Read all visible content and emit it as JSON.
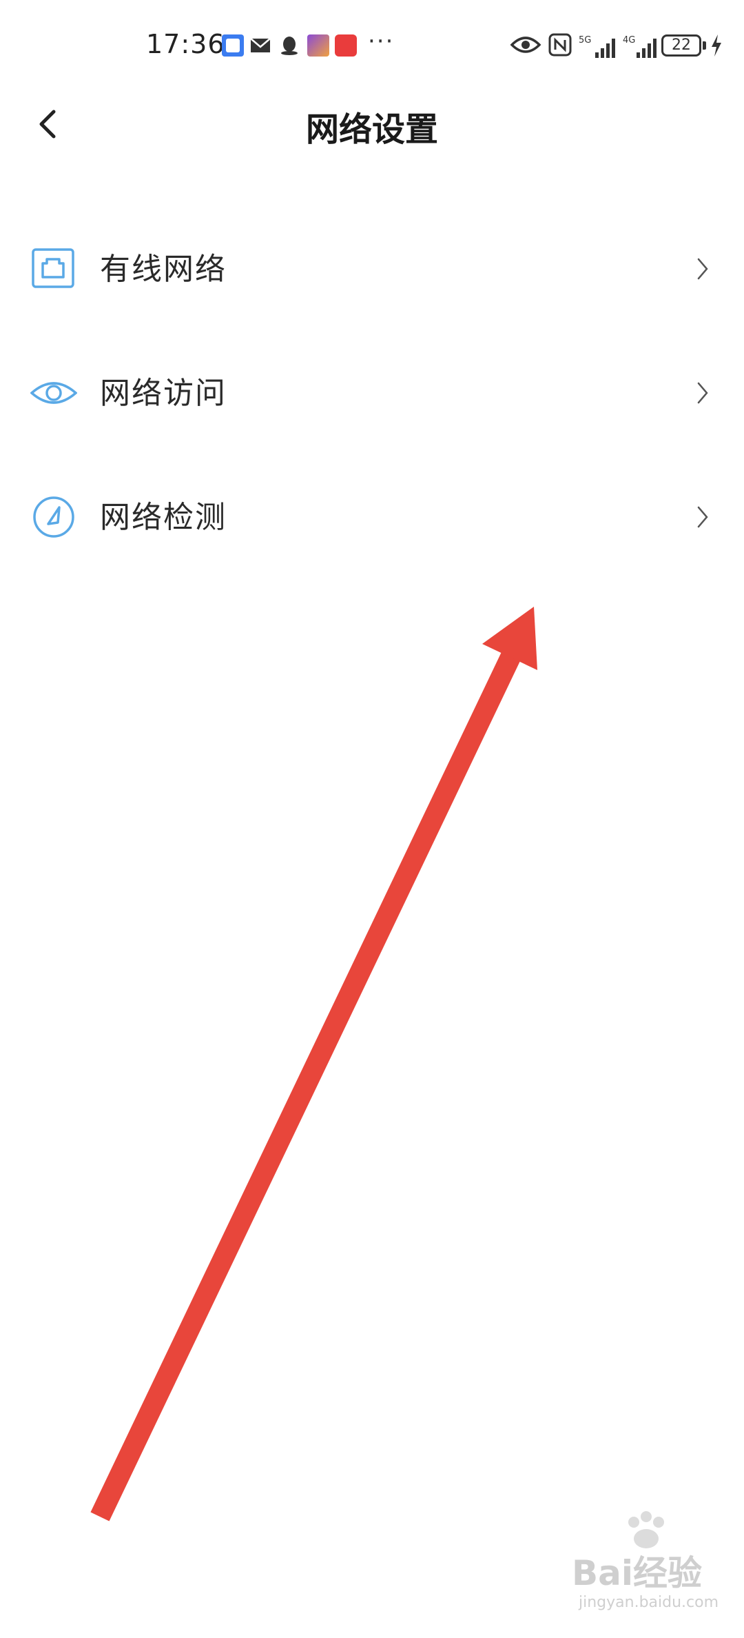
{
  "status_bar": {
    "time": "17:36",
    "more_indicator": "···",
    "battery_level": "22",
    "network_5g": "5G",
    "network_4g": "4G",
    "icons": [
      "app-notification-icon",
      "mail-icon",
      "qq-icon",
      "app-notification-icon",
      "shopping-618-icon",
      "eye-comfort-icon",
      "nfc-icon",
      "signal-5g-icon",
      "signal-4g-icon",
      "battery-icon",
      "charging-icon"
    ]
  },
  "header": {
    "title": "网络设置"
  },
  "menu": {
    "items": [
      {
        "label": "有线网络",
        "icon": "ethernet-port-icon"
      },
      {
        "label": "网络访问",
        "icon": "eye-icon"
      },
      {
        "label": "网络检测",
        "icon": "speedometer-icon"
      }
    ]
  },
  "colors": {
    "icon_blue": "#5aa9e6",
    "arrow_red": "#e8463b",
    "title_text": "#1a1a1a",
    "item_text": "#2a2a2a"
  },
  "watermark": {
    "brand": "Bai经验",
    "site": "jingyan.baidu.com"
  }
}
